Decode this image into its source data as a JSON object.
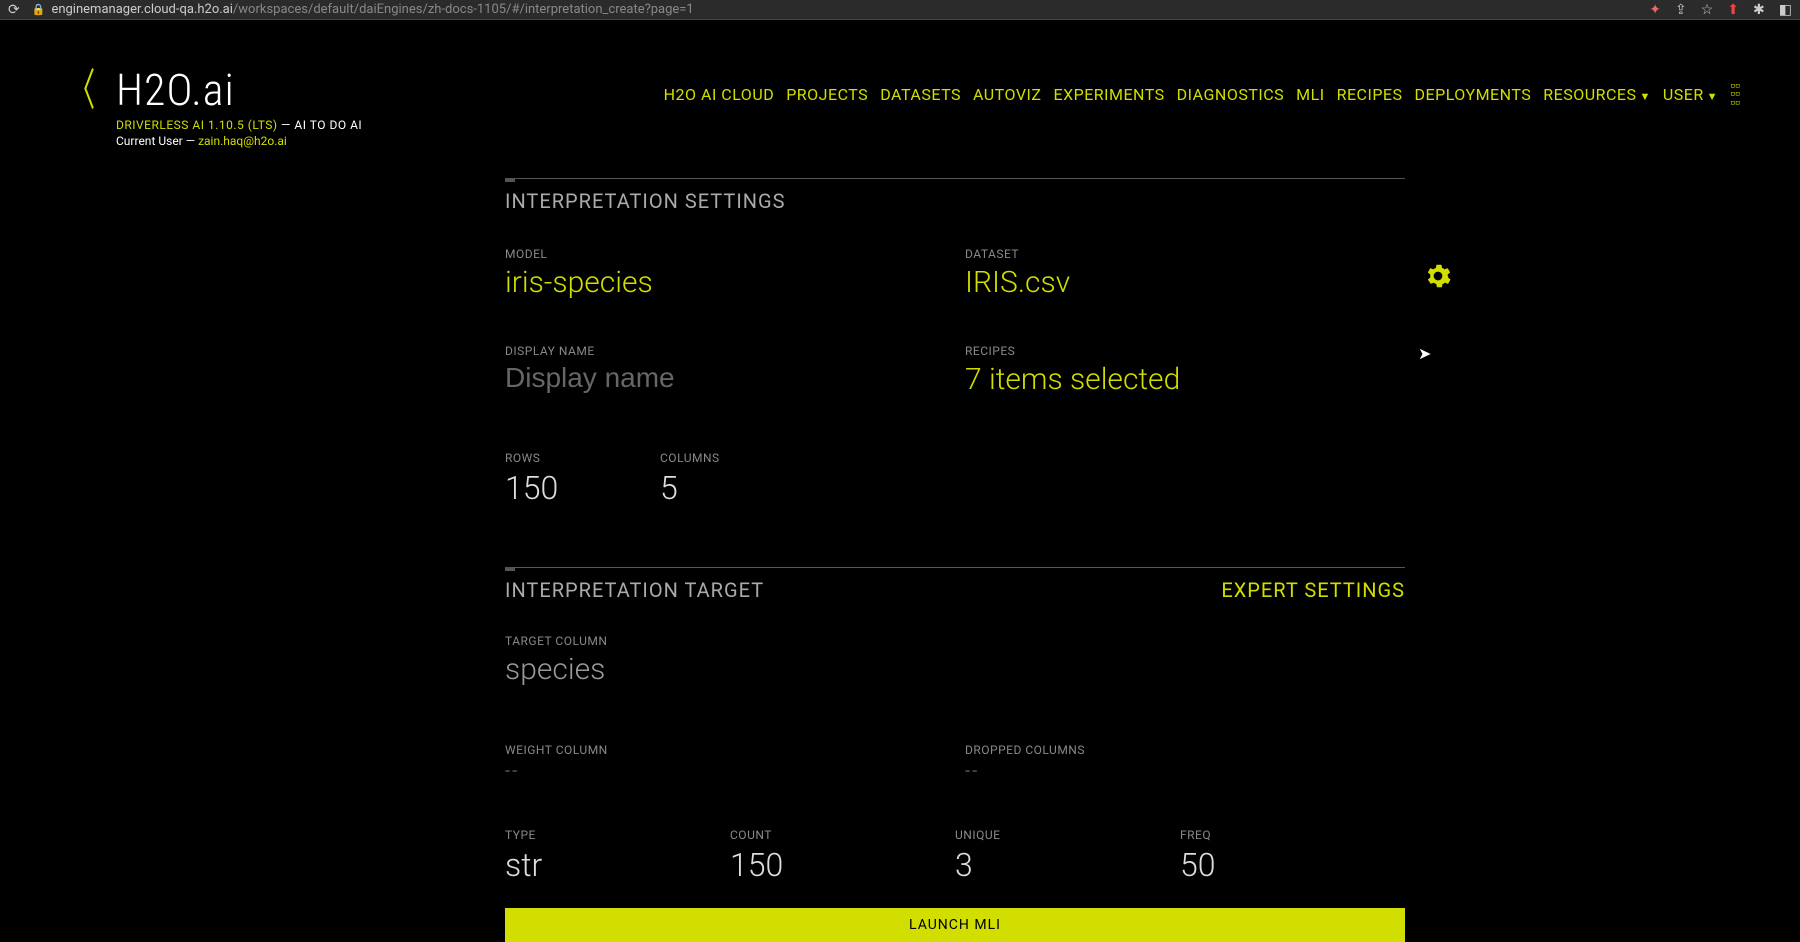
{
  "browser": {
    "url_host": "enginemanager.cloud-qa.h2o.ai",
    "url_path": "/workspaces/default/daiEngines/zh-docs-1105/#/interpretation_create?page=1"
  },
  "header": {
    "logo": "H2O.ai",
    "version_line": "DRIVERLESS AI 1.10.5 (LTS)",
    "tagline": " — AI TO DO AI",
    "user_label": "Current User — ",
    "user_email": "zain.haq@h2o.ai"
  },
  "nav": {
    "items": [
      "H2O AI CLOUD",
      "PROJECTS",
      "DATASETS",
      "AUTOVIZ",
      "EXPERIMENTS",
      "DIAGNOSTICS",
      "MLI",
      "RECIPES",
      "DEPLOYMENTS"
    ],
    "resources": "RESOURCES",
    "user": "USER"
  },
  "settings": {
    "title": "INTERPRETATION SETTINGS",
    "model_label": "MODEL",
    "model_value": "iris-species",
    "dataset_label": "DATASET",
    "dataset_value": "IRIS.csv",
    "display_name_label": "DISPLAY NAME",
    "display_name_placeholder": "Display name",
    "recipes_label": "RECIPES",
    "recipes_value": "7 items selected",
    "rows_label": "ROWS",
    "rows_value": "150",
    "columns_label": "COLUMNS",
    "columns_value": "5"
  },
  "target": {
    "title": "INTERPRETATION TARGET",
    "expert_link": "EXPERT SETTINGS",
    "target_col_label": "TARGET COLUMN",
    "target_col_value": "species",
    "weight_col_label": "WEIGHT COLUMN",
    "weight_col_value": "--",
    "dropped_col_label": "DROPPED COLUMNS",
    "dropped_col_value": "--",
    "type_label": "TYPE",
    "type_value": "str",
    "count_label": "COUNT",
    "count_value": "150",
    "unique_label": "UNIQUE",
    "unique_value": "3",
    "freq_label": "FREQ",
    "freq_value": "50"
  },
  "launch_label": "LAUNCH MLI"
}
